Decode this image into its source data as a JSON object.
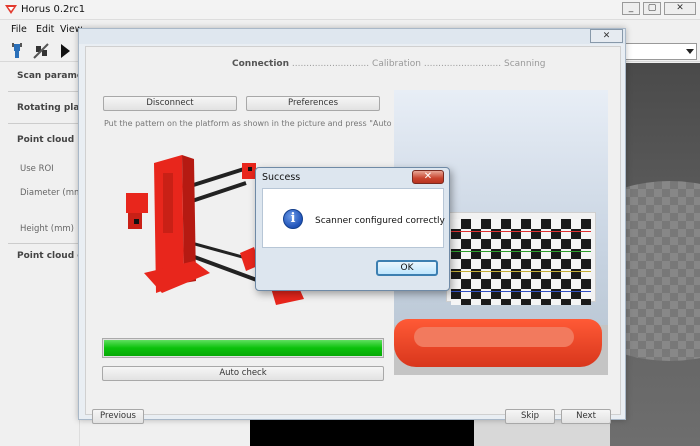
{
  "window": {
    "title": "Horus 0.2rc1",
    "controls": {
      "minimize": "_",
      "maximize": "▢",
      "close": "✕"
    }
  },
  "menu": [
    "File",
    "Edit",
    "View"
  ],
  "side_panel": {
    "scan_parameters": "Scan paramete",
    "rotating_platform": "Rotating platfo",
    "point_cloud_roi": "Point cloud ROI",
    "use_roi": "Use ROI",
    "diameter": "Diameter (mm)",
    "height": "Height (mm)",
    "point_cloud_color": "Point cloud colo"
  },
  "wizard": {
    "close_label": "✕",
    "steps": [
      {
        "label": "Connection",
        "active": true
      },
      {
        "label": "Calibration",
        "active": false
      },
      {
        "label": "Scanning",
        "active": false
      }
    ],
    "step_separator": "...........................",
    "disconnect_label": "Disconnect",
    "preferences_label": "Preferences",
    "instruction": "Put the pattern on the platform as shown in the picture and press \"Auto check\"",
    "progress": 1.0,
    "progress_color": "#0cc10c",
    "auto_check_label": "Auto check",
    "previous_label": "Previous",
    "skip_label": "Skip",
    "next_label": "Next"
  },
  "modal": {
    "title": "Success",
    "close_label": "✕",
    "icon": "info-icon",
    "icon_glyph": "i",
    "message": "Scanner configured correctly",
    "ok_label": "OK"
  },
  "colors": {
    "scanner_red": "#e8261c",
    "accent_blue": "#3c7fb1"
  }
}
